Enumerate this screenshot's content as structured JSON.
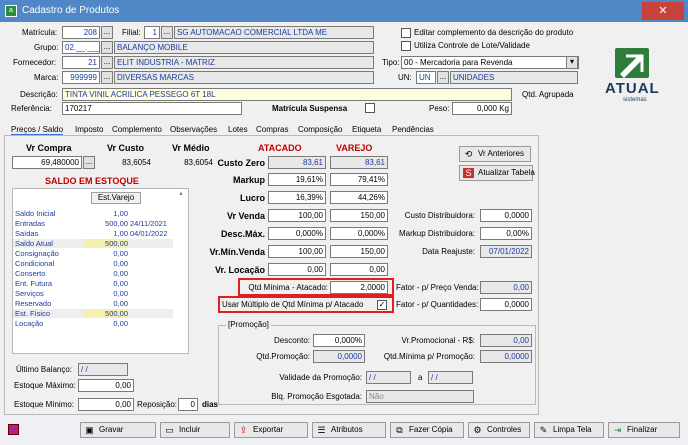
{
  "window": {
    "title": "Cadastro de Produtos",
    "close_icon": "✕"
  },
  "header": {
    "matricula_label": "Matrícula:",
    "matricula_value": "208",
    "filial_label": "Filial:",
    "filial_value": "1",
    "filial_name": "SG AUTOMACAO COMERCIAL LTDA ME",
    "grupo_label": "Grupo:",
    "grupo_value": "02.__.___",
    "grupo_name": "BALANÇO MOBILE",
    "fornecedor_label": "Fornecedor:",
    "fornecedor_value": "21",
    "fornecedor_name": "ELIT INDUSTRIA - MATRIZ",
    "marca_label": "Marca:",
    "marca_value": "999999",
    "marca_name": "DIVERSAS MARCAS",
    "descricao_label": "Descrição:",
    "descricao_value": "TINTA VINIL ACRILICA PESSEGO 6T 18L",
    "referencia_label": "Referência:",
    "referencia_value": "170217",
    "editar_label": "Editar complemento da descrição do produto",
    "lote_label": "Utiliza Controle de Lote/Validade",
    "tipo_label": "Tipo:",
    "tipo_value": "00 - Mercadoria para Revenda",
    "un_label": "UN:",
    "un_value": "UN",
    "un_name": "UNIDADES",
    "qtd_agrupada_label": "Qtd. Agrupada",
    "matricula_suspensa_label": "Matrícula Suspensa",
    "peso_label": "Peso:",
    "peso_value": "0,000 Kg",
    "ellipsis": "..."
  },
  "logo": {
    "text": "ATUAL",
    "sub": "sistemas"
  },
  "tabs": [
    "Preços / Saldo",
    "Imposto",
    "Complemento",
    "Observações",
    "Lotes",
    "Compras",
    "Composição",
    "Etiqueta",
    "Pendências"
  ],
  "precos": {
    "vr_compra_label": "Vr Compra",
    "vr_compra_value": "69,480000",
    "vr_custo_label": "Vr Custo",
    "vr_custo_value": "83,6054",
    "vr_medio_label": "Vr Médio",
    "vr_medio_value": "83,6054",
    "atacado_label": "ATACADO",
    "varejo_label": "VAREJO",
    "rows": [
      {
        "label": "Custo Zero",
        "atacado": "83,61",
        "varejo": "83,61"
      },
      {
        "label": "Markup",
        "atacado": "19,61%",
        "varejo": "79,41%"
      },
      {
        "label": "Lucro",
        "atacado": "16,39%",
        "varejo": "44,26%"
      },
      {
        "label": "Vr Venda",
        "atacado": "100,00",
        "varejo": "150,00"
      },
      {
        "label": "Desc.Máx.",
        "atacado": "0,000%",
        "varejo": "0,000%"
      },
      {
        "label": "Vr.Mín.Venda",
        "atacado": "100,00",
        "varejo": "150,00"
      },
      {
        "label": "Vr. Locação",
        "atacado": "0,00",
        "varejo": "0,00"
      }
    ],
    "vr_anteriores": "Vr Anteriores",
    "atualizar_tabela": "Atualizar Tabela",
    "custo_distribuidora_label": "Custo Distribuidora:",
    "custo_distribuidora_value": "0,0000",
    "markup_distribuidora_label": "Markup Distribuidora:",
    "markup_distribuidora_value": "0,00%",
    "data_reajuste_label": "Data Reajuste:",
    "data_reajuste_value": "07/01/2022",
    "qtd_minima_label": "Qtd Mínima - Atacado:",
    "qtd_minima_value": "2,0000",
    "usar_multiplo_label": "Usar Múltiplo de Qtd Mínima p/ Atacado",
    "fator_preco_label": "Fator - p/ Preço Venda:",
    "fator_preco_value": "0,00",
    "fator_qtd_label": "Fator - p/ Quantidades:",
    "fator_qtd_value": "0,0000"
  },
  "saldo": {
    "title": "SALDO EM ESTOQUE",
    "col_header": "Est.Varejo",
    "rows": [
      {
        "label": "Saldo Inicial",
        "value": "1,00",
        "date": ""
      },
      {
        "label": "Entradas",
        "value": "500,00",
        "date": "24/11/2021"
      },
      {
        "label": "Saídas",
        "value": "1,00",
        "date": "04/01/2022"
      },
      {
        "label": "Saldo Atual",
        "value": "500,00",
        "date": ""
      },
      {
        "label": "Consignação",
        "value": "0,00",
        "date": ""
      },
      {
        "label": "Condicional",
        "value": "0,00",
        "date": ""
      },
      {
        "label": "Conserto",
        "value": "0,00",
        "date": ""
      },
      {
        "label": "Ent. Futura",
        "value": "0,00",
        "date": ""
      },
      {
        "label": "Serviços",
        "value": "0,00",
        "date": ""
      },
      {
        "label": "Reservado",
        "value": "0,00",
        "date": ""
      },
      {
        "label": "Est. Físico",
        "value": "500,00",
        "date": ""
      },
      {
        "label": "Locação",
        "value": "0,00",
        "date": ""
      }
    ],
    "ultimo_balanco_label": "Último Balanço:",
    "ultimo_balanco_value": "/ /",
    "estoque_maximo_label": "Estoque Máximo:",
    "estoque_maximo_value": "0,00",
    "estoque_minimo_label": "Estoque Mínimo:",
    "estoque_minimo_value": "0,00",
    "reposicao_label": "Reposição:",
    "reposicao_value": "0",
    "dias_label": "dias"
  },
  "promocao": {
    "title": "[Promoção]",
    "desconto_label": "Desconto:",
    "desconto_value": "0,000%",
    "vr_promocional_label": "Vr.Promocional - R$:",
    "vr_promocional_value": "0,00",
    "qtd_promocao_label": "Qtd.Promoção:",
    "qtd_promocao_value": "0,0000",
    "qtd_minima_promocao_label": "Qtd.Mínima p/ Promoção:",
    "qtd_minima_promocao_value": "0,0000",
    "validade_label": "Validade da Promoção:",
    "validade_de": "/ /",
    "validade_a_label": "a",
    "validade_ate": "/ /",
    "blq_label": "Blq. Promoção Esgotada:",
    "blq_value": "Não"
  },
  "toolbar": [
    "Gravar",
    "Incluir",
    "Exportar",
    "Atributos",
    "Fazer Cópia",
    "Controles",
    "Limpa Tela",
    "Finalizar"
  ]
}
